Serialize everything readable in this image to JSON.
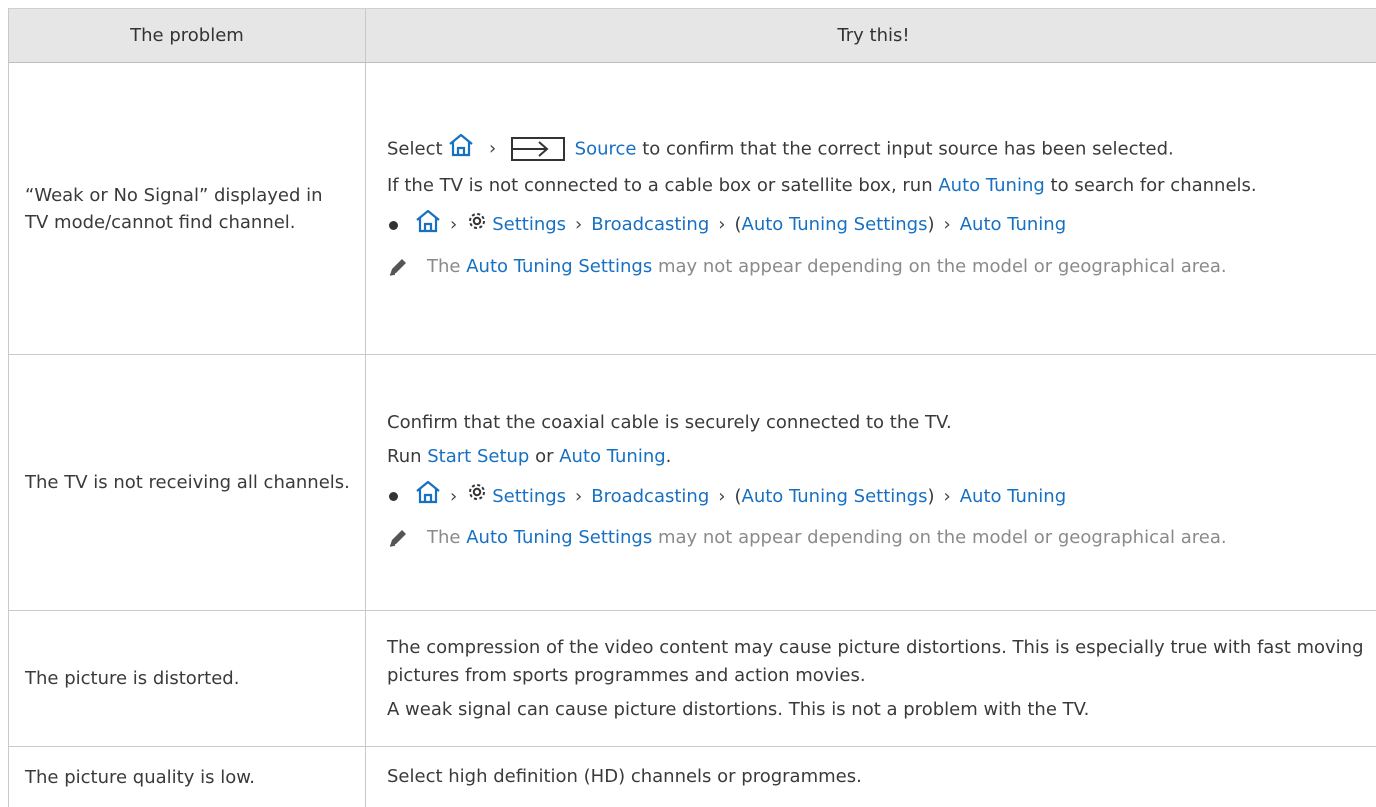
{
  "header": {
    "col_problem": "The problem",
    "col_try": "Try this!"
  },
  "rows": [
    {
      "problem": "“Weak or No Signal” displayed in TV mode/cannot find channel.",
      "line1": {
        "select": "Select",
        "source": "Source",
        "rest": "to confirm that the correct input source has been selected."
      },
      "line2": {
        "pre": "If the TV is not connected to a cable box or satellite box, run",
        "link": "Auto Tuning",
        "post": "to search for channels."
      },
      "path": {
        "settings": "Settings",
        "broadcasting": "Broadcasting",
        "open": "(",
        "auto_tuning_settings": "Auto Tuning Settings",
        "close": ")",
        "auto_tuning": "Auto Tuning"
      },
      "note": {
        "pre": "The",
        "link": "Auto Tuning Settings",
        "post": "may not appear depending on the model or geographical area."
      }
    },
    {
      "problem": "The TV is not receiving all channels.",
      "line1": "Confirm that the coaxial cable is securely connected to the TV.",
      "line2": {
        "pre": "Run",
        "link1": "Start Setup",
        "mid": "or",
        "link2": "Auto Tuning",
        "post": "."
      },
      "path": {
        "settings": "Settings",
        "broadcasting": "Broadcasting",
        "open": "(",
        "auto_tuning_settings": "Auto Tuning Settings",
        "close": ")",
        "auto_tuning": "Auto Tuning"
      },
      "note": {
        "pre": "The",
        "link": "Auto Tuning Settings",
        "post": "may not appear depending on the model or geographical area."
      }
    },
    {
      "problem": "The picture is distorted.",
      "line1": "The compression of the video content may cause picture distortions. This is especially true with fast moving pictures from sports programmes and action movies.",
      "line2": "A weak signal can cause picture distortions. This is not a problem with the TV."
    },
    {
      "problem": "The picture quality is low.",
      "line1": "Select high definition (HD) channels or programmes."
    }
  ],
  "icons": [
    "home-icon",
    "source-icon",
    "gear-icon",
    "chevron-right-icon",
    "pencil-icon",
    "bullet-icon"
  ],
  "colors": {
    "link": "#1770c2",
    "header_bg": "#e6e6e6",
    "note_text": "#8a8a8a"
  }
}
